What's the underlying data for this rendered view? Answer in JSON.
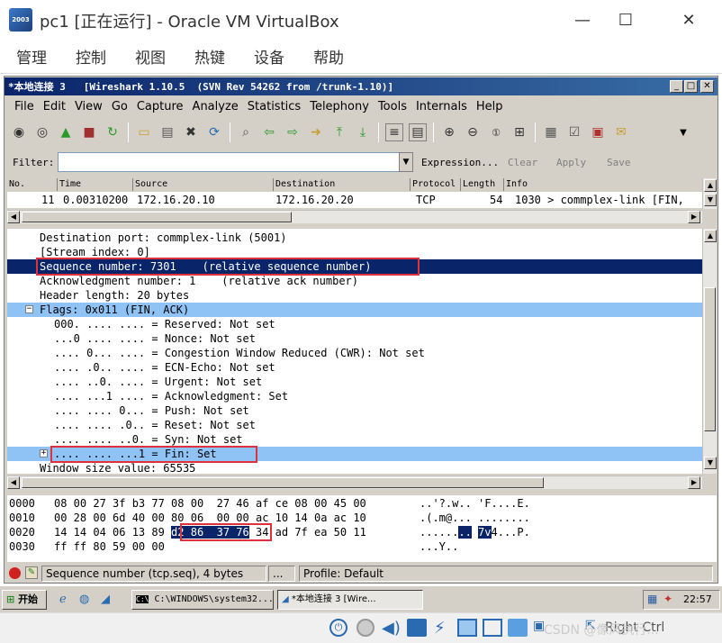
{
  "vbox": {
    "title": "pc1 [正在运行] - Oracle VM VirtualBox",
    "icon_text": "2003",
    "menu": [
      "管理",
      "控制",
      "视图",
      "热键",
      "设备",
      "帮助"
    ]
  },
  "ws": {
    "window_title": "*本地连接 3   [Wireshark 1.10.5  (SVN Rev 54262 from /trunk-1.10)]",
    "menu": [
      "File",
      "Edit",
      "View",
      "Go",
      "Capture",
      "Analyze",
      "Statistics",
      "Telephony",
      "Tools",
      "Internals",
      "Help"
    ],
    "filter_label": "Filter:",
    "filter_value": "",
    "expression": "Expression...",
    "clear": "Clear",
    "apply": "Apply",
    "save": "Save",
    "columns": [
      "No.",
      "Time",
      "Source",
      "Destination",
      "Protocol",
      "Length",
      "Info"
    ],
    "packet": {
      "no": "11",
      "time": "0.00310200",
      "source": "172.16.20.10",
      "destination": "172.16.20.20",
      "protocol": "TCP",
      "length": "54",
      "info": "1030 > commplex-link [FIN,"
    },
    "details": [
      "Destination port: commplex-link (5001)",
      "[Stream index: 0]",
      "Sequence number: 7301    (relative sequence number)",
      "Acknowledgment number: 1    (relative ack number)",
      "Header length: 20 bytes",
      "Flags: 0x011 (FIN, ACK)",
      "000. .... .... = Reserved: Not set",
      "...0 .... .... = Nonce: Not set",
      ".... 0... .... = Congestion Window Reduced (CWR): Not set",
      ".... .0.. .... = ECN-Echo: Not set",
      ".... ..0. .... = Urgent: Not set",
      ".... ...1 .... = Acknowledgment: Set",
      ".... .... 0... = Push: Not set",
      ".... .... .0.. = Reset: Not set",
      ".... .... ..0. = Syn: Not set",
      ".... .... ...1 = Fin: Set",
      "Window size value: 65535"
    ],
    "hex": [
      {
        "off": "0000",
        "bytes": "08 00 27 3f b3 77 08 00  27 46 af ce 08 00 45 00",
        "ascii": "..'?.w.. 'F....E."
      },
      {
        "off": "0010",
        "bytes": "00 28 00 6d 40 00 80 06  00 00 ac 10 14 0a ac 10",
        "ascii": ".(.m@... ........"
      },
      {
        "off": "0020",
        "bytes_a": "14 14 04 06 13 89 ",
        "bytes_sel": "d2 86  37 76",
        "bytes_b": " 34 ad 7f ea 50 11",
        "ascii_a": "......",
        "ascii_sel": "..",
        "ascii_mid": " ",
        "ascii_sel2": "7v",
        "ascii_b": "4...P."
      },
      {
        "off": "0030",
        "bytes": "ff ff 80 59 00 00",
        "ascii": "...Y.."
      }
    ],
    "status_field": "Sequence number (tcp.seq), 4 bytes",
    "status_mid": "...",
    "status_profile": "Profile: Default"
  },
  "taskbar": {
    "start": "开始",
    "task1": "C:\\WINDOWS\\system32...",
    "task2": "*本地连接 3   [Wire...",
    "clock": "22:57"
  },
  "vbstatus": {
    "host_key": "Right Ctrl"
  },
  "watermark": "CSDN @像风执行..."
}
